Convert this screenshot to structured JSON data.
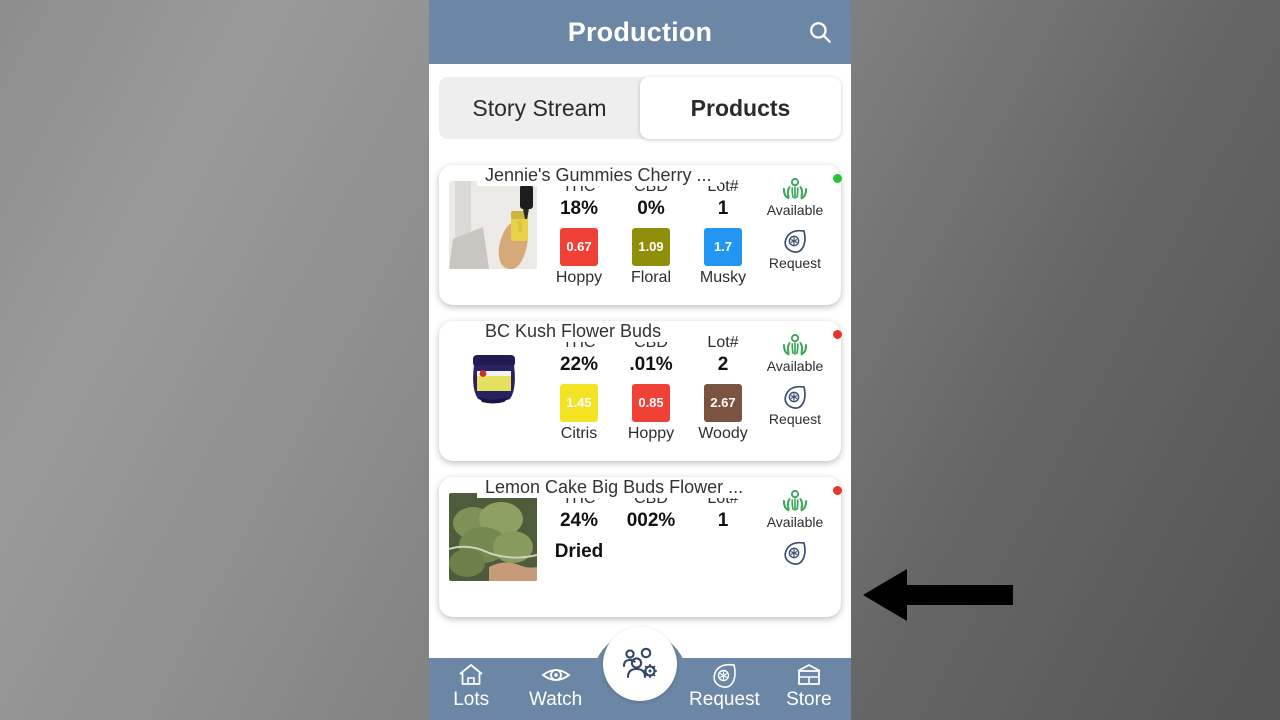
{
  "appbar": {
    "title": "Production",
    "search_icon": "search-icon"
  },
  "tabs": [
    {
      "label": "Story Stream",
      "active": false
    },
    {
      "label": "Products",
      "active": true
    }
  ],
  "stat_headers": {
    "thc": "THC",
    "cbd": "CBD",
    "lot": "Lot#"
  },
  "actions": {
    "available_label": "Available",
    "request_label": "Request",
    "available_icon": "hands-plant-icon",
    "request_icon": "leaf-request-icon"
  },
  "colors": {
    "appbar": "#6c87a6",
    "status_available": "#27c23c",
    "status_unavailable": "#e8342a",
    "chip_hoppy": "#ef4136",
    "chip_floral": "#8f8f09",
    "chip_musky": "#2196f3",
    "chip_citris": "#f4e322",
    "chip_woody": "#7a5341"
  },
  "products": [
    {
      "title": "Jennie's Gummies Cherry ...",
      "thumb": "oil-dropper-photo",
      "thc": "18%",
      "cbd": "0%",
      "lot": "1",
      "status": "available",
      "status_color": "#27c23c",
      "chips": [
        {
          "value": "0.67",
          "name": "Hoppy",
          "color": "#ef4136"
        },
        {
          "value": "1.09",
          "name": "Floral",
          "color": "#8f8f09"
        },
        {
          "value": "1.7",
          "name": "Musky",
          "color": "#2196f3"
        }
      ]
    },
    {
      "title": "BC Kush Flower Buds",
      "thumb": "navy-jar-photo",
      "thc": "22%",
      "cbd": ".01%",
      "lot": "2",
      "status": "unavailable",
      "status_color": "#e8342a",
      "chips": [
        {
          "value": "1.45",
          "name": "Citris",
          "color": "#f4e322"
        },
        {
          "value": "0.85",
          "name": "Hoppy",
          "color": "#ef4136"
        },
        {
          "value": "2.67",
          "name": "Woody",
          "color": "#7a5341"
        }
      ]
    },
    {
      "title": "Lemon Cake Big Buds Flower ...",
      "thumb": "cannabis-bud-photo",
      "thc": "24%",
      "cbd": "002%",
      "lot": "1",
      "status": "unavailable",
      "status_color": "#e8342a",
      "partial_text": "Dried",
      "chips": []
    }
  ],
  "bottom_nav": [
    {
      "label": "Lots",
      "icon": "home-icon"
    },
    {
      "label": "Watch",
      "icon": "eye-icon"
    },
    {
      "label": "",
      "icon": "people-gear-icon"
    },
    {
      "label": "Request",
      "icon": "leaf-request-icon"
    },
    {
      "label": "Store",
      "icon": "store-icon"
    }
  ],
  "annotation": {
    "arrow": "left-pointing-arrow"
  }
}
